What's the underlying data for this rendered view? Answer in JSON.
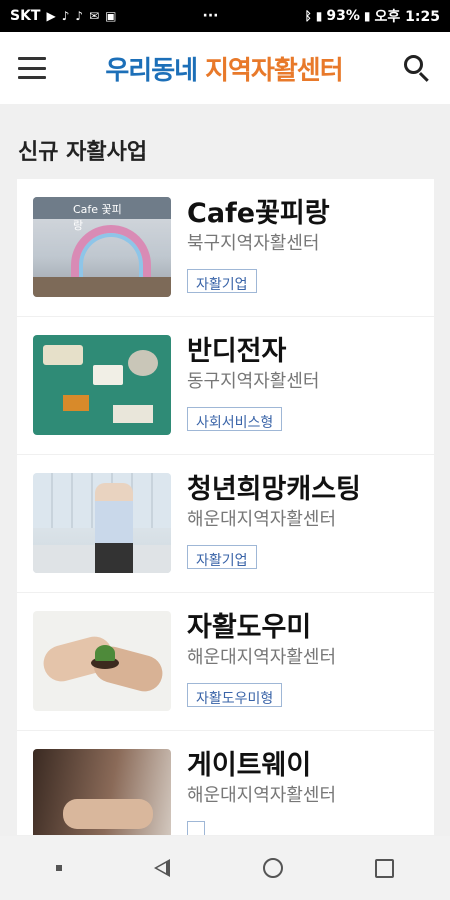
{
  "status_bar": {
    "carrier": "SKT",
    "battery": "93%",
    "time": "오후 1:25",
    "more": "···"
  },
  "app_bar": {
    "brand_part1": "우리동네 ",
    "brand_part2": "지역자활센터"
  },
  "section": {
    "title": "신규 자활사업"
  },
  "items": [
    {
      "title": "Cafe꽃피랑",
      "center": "북구지역자활센터",
      "tag": "자활기업",
      "thumb_sign": "Cafe 꽃피랑"
    },
    {
      "title": "반디전자",
      "center": "동구지역자활센터",
      "tag": "사회서비스형"
    },
    {
      "title": "청년희망캐스팅",
      "center": "해운대지역자활센터",
      "tag": "자활기업"
    },
    {
      "title": "자활도우미",
      "center": "해운대지역자활센터",
      "tag": "자활도우미형"
    },
    {
      "title": "게이트웨이",
      "center": "해운대지역자활센터",
      "tag": ""
    }
  ]
}
